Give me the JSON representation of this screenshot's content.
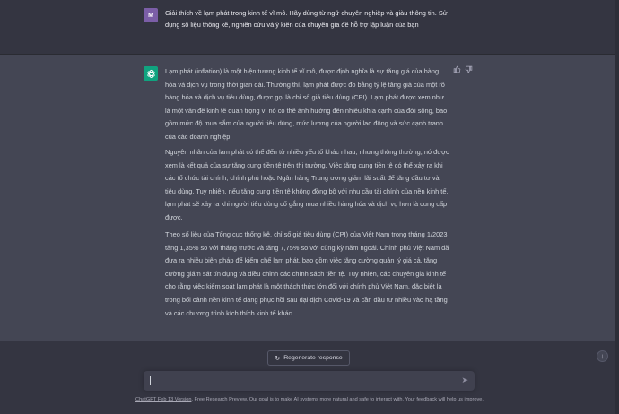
{
  "user_message": {
    "avatar_initials": "M",
    "text": "Giải thích về lạm phát trong kinh tế vĩ mô. Hãy dùng từ ngữ chuyên nghiệp và giàu thông tin. Sử dụng số liệu thống kê, nghiên cứu và ý kiến của chuyên gia để hỗ trợ lập luận của bạn"
  },
  "assistant_message": {
    "avatar_icon": "openai-logo-icon",
    "paragraphs": [
      "Lạm phát (inflation) là một hiện tượng kinh tế vĩ mô, được định nghĩa là sự tăng giá của hàng hóa và dịch vụ trong thời gian dài. Thường thì, lạm phát được đo bằng tỷ lệ tăng giá của một rổ hàng hóa và dịch vụ tiêu dùng, được gọi là chỉ số giá tiêu dùng (CPI). Lạm phát được xem như là một vấn đề kinh tế quan trọng vì nó có thể ảnh hưởng đến nhiều khía cạnh của đời sống, bao gồm mức độ mua sắm của người tiêu dùng, mức lương của người lao động và sức cạnh tranh của các doanh nghiệp.",
      "Nguyên nhân của lạm phát có thể đến từ nhiều yếu tố khác nhau, nhưng thông thường, nó được xem là kết quả của sự tăng cung tiền tệ trên thị trường. Việc tăng cung tiền tệ có thể xảy ra khi các tổ chức tài chính, chính phủ hoặc Ngân hàng Trung ương giảm lãi suất để tăng đầu tư và tiêu dùng. Tuy nhiên, nếu tăng cung tiền tệ không đồng bộ với nhu cầu tài chính của nền kinh tế, lạm phát sẽ xảy ra khi người tiêu dùng cố gắng mua nhiều hàng hóa và dịch vụ hơn là cung cấp được.",
      "Theo số liệu của Tổng cục thống kê, chỉ số giá tiêu dùng (CPI) của Việt Nam trong tháng 1/2023 tăng 1,35% so với tháng trước và tăng 7,75% so với cùng kỳ năm ngoái. Chính phủ Việt Nam đã đưa ra nhiều biện pháp để kiểm chế lạm phát, bao gồm việc tăng cường quản lý giá cả, tăng cường giám sát tín dụng và điều chỉnh các chính sách tiền tệ. Tuy nhiên, các chuyên gia kinh tế cho rằng việc kiểm soát lạm phát là một thách thức lớn đối với chính phủ Việt Nam, đặc biệt là trong bối cảnh nền kinh tế đang phục hồi sau đại dịch Covid-19 và cần đầu tư nhiều vào hạ tầng và các chương trình kích thích kinh tế khác."
    ],
    "thumbs_up_icon": "thumbs-up-icon",
    "thumbs_down_icon": "thumbs-down-icon"
  },
  "regenerate": {
    "label": "Regenerate response",
    "icon": "refresh-icon"
  },
  "composer": {
    "placeholder": "",
    "send_icon": "send-icon"
  },
  "scroll_down_icon": "arrow-down-icon",
  "footer": {
    "link_text": "ChatGPT Feb 13 Version",
    "text": ". Free Research Preview. Our goal is to make AI systems more natural and safe to interact with. Your feedback will help us improve."
  },
  "colors": {
    "background": "#343541",
    "assistant_row": "#444654",
    "user_avatar": "#7b5ea7",
    "assistant_avatar": "#10a37f"
  }
}
